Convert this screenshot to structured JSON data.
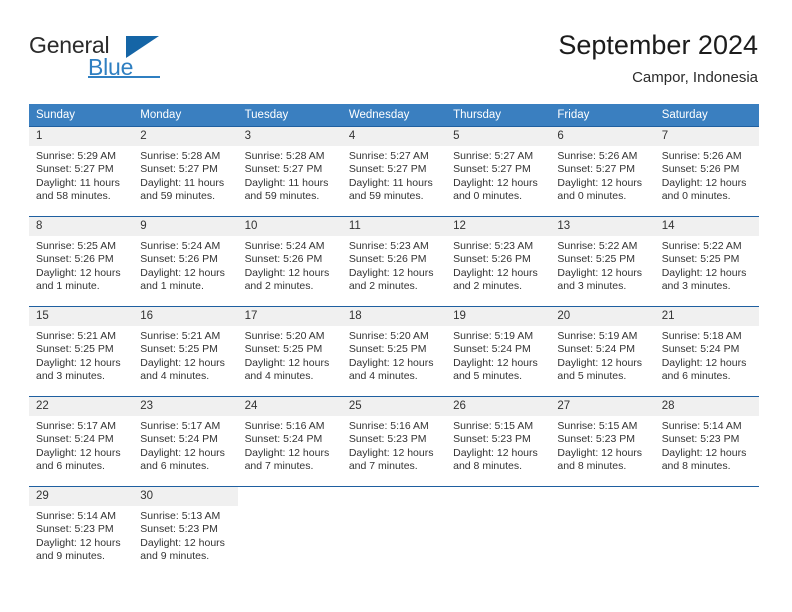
{
  "brand": {
    "name_part1": "General",
    "name_part2": "Blue",
    "logo_icon": "triangle-flag-icon"
  },
  "header": {
    "month_title": "September 2024",
    "location": "Campor, Indonesia"
  },
  "calendar": {
    "weekday_headers": [
      "Sunday",
      "Monday",
      "Tuesday",
      "Wednesday",
      "Thursday",
      "Friday",
      "Saturday"
    ],
    "accent_color": "#3a7fc0",
    "border_color": "#1f5fa0",
    "daynum_band_color": "#f0f0f0",
    "weeks": [
      [
        {
          "day": "1",
          "sunrise": "Sunrise: 5:29 AM",
          "sunset": "Sunset: 5:27 PM",
          "daylight_line1": "Daylight: 11 hours",
          "daylight_line2": "and 58 minutes."
        },
        {
          "day": "2",
          "sunrise": "Sunrise: 5:28 AM",
          "sunset": "Sunset: 5:27 PM",
          "daylight_line1": "Daylight: 11 hours",
          "daylight_line2": "and 59 minutes."
        },
        {
          "day": "3",
          "sunrise": "Sunrise: 5:28 AM",
          "sunset": "Sunset: 5:27 PM",
          "daylight_line1": "Daylight: 11 hours",
          "daylight_line2": "and 59 minutes."
        },
        {
          "day": "4",
          "sunrise": "Sunrise: 5:27 AM",
          "sunset": "Sunset: 5:27 PM",
          "daylight_line1": "Daylight: 11 hours",
          "daylight_line2": "and 59 minutes."
        },
        {
          "day": "5",
          "sunrise": "Sunrise: 5:27 AM",
          "sunset": "Sunset: 5:27 PM",
          "daylight_line1": "Daylight: 12 hours",
          "daylight_line2": "and 0 minutes."
        },
        {
          "day": "6",
          "sunrise": "Sunrise: 5:26 AM",
          "sunset": "Sunset: 5:27 PM",
          "daylight_line1": "Daylight: 12 hours",
          "daylight_line2": "and 0 minutes."
        },
        {
          "day": "7",
          "sunrise": "Sunrise: 5:26 AM",
          "sunset": "Sunset: 5:26 PM",
          "daylight_line1": "Daylight: 12 hours",
          "daylight_line2": "and 0 minutes."
        }
      ],
      [
        {
          "day": "8",
          "sunrise": "Sunrise: 5:25 AM",
          "sunset": "Sunset: 5:26 PM",
          "daylight_line1": "Daylight: 12 hours",
          "daylight_line2": "and 1 minute."
        },
        {
          "day": "9",
          "sunrise": "Sunrise: 5:24 AM",
          "sunset": "Sunset: 5:26 PM",
          "daylight_line1": "Daylight: 12 hours",
          "daylight_line2": "and 1 minute."
        },
        {
          "day": "10",
          "sunrise": "Sunrise: 5:24 AM",
          "sunset": "Sunset: 5:26 PM",
          "daylight_line1": "Daylight: 12 hours",
          "daylight_line2": "and 2 minutes."
        },
        {
          "day": "11",
          "sunrise": "Sunrise: 5:23 AM",
          "sunset": "Sunset: 5:26 PM",
          "daylight_line1": "Daylight: 12 hours",
          "daylight_line2": "and 2 minutes."
        },
        {
          "day": "12",
          "sunrise": "Sunrise: 5:23 AM",
          "sunset": "Sunset: 5:26 PM",
          "daylight_line1": "Daylight: 12 hours",
          "daylight_line2": "and 2 minutes."
        },
        {
          "day": "13",
          "sunrise": "Sunrise: 5:22 AM",
          "sunset": "Sunset: 5:25 PM",
          "daylight_line1": "Daylight: 12 hours",
          "daylight_line2": "and 3 minutes."
        },
        {
          "day": "14",
          "sunrise": "Sunrise: 5:22 AM",
          "sunset": "Sunset: 5:25 PM",
          "daylight_line1": "Daylight: 12 hours",
          "daylight_line2": "and 3 minutes."
        }
      ],
      [
        {
          "day": "15",
          "sunrise": "Sunrise: 5:21 AM",
          "sunset": "Sunset: 5:25 PM",
          "daylight_line1": "Daylight: 12 hours",
          "daylight_line2": "and 3 minutes."
        },
        {
          "day": "16",
          "sunrise": "Sunrise: 5:21 AM",
          "sunset": "Sunset: 5:25 PM",
          "daylight_line1": "Daylight: 12 hours",
          "daylight_line2": "and 4 minutes."
        },
        {
          "day": "17",
          "sunrise": "Sunrise: 5:20 AM",
          "sunset": "Sunset: 5:25 PM",
          "daylight_line1": "Daylight: 12 hours",
          "daylight_line2": "and 4 minutes."
        },
        {
          "day": "18",
          "sunrise": "Sunrise: 5:20 AM",
          "sunset": "Sunset: 5:25 PM",
          "daylight_line1": "Daylight: 12 hours",
          "daylight_line2": "and 4 minutes."
        },
        {
          "day": "19",
          "sunrise": "Sunrise: 5:19 AM",
          "sunset": "Sunset: 5:24 PM",
          "daylight_line1": "Daylight: 12 hours",
          "daylight_line2": "and 5 minutes."
        },
        {
          "day": "20",
          "sunrise": "Sunrise: 5:19 AM",
          "sunset": "Sunset: 5:24 PM",
          "daylight_line1": "Daylight: 12 hours",
          "daylight_line2": "and 5 minutes."
        },
        {
          "day": "21",
          "sunrise": "Sunrise: 5:18 AM",
          "sunset": "Sunset: 5:24 PM",
          "daylight_line1": "Daylight: 12 hours",
          "daylight_line2": "and 6 minutes."
        }
      ],
      [
        {
          "day": "22",
          "sunrise": "Sunrise: 5:17 AM",
          "sunset": "Sunset: 5:24 PM",
          "daylight_line1": "Daylight: 12 hours",
          "daylight_line2": "and 6 minutes."
        },
        {
          "day": "23",
          "sunrise": "Sunrise: 5:17 AM",
          "sunset": "Sunset: 5:24 PM",
          "daylight_line1": "Daylight: 12 hours",
          "daylight_line2": "and 6 minutes."
        },
        {
          "day": "24",
          "sunrise": "Sunrise: 5:16 AM",
          "sunset": "Sunset: 5:24 PM",
          "daylight_line1": "Daylight: 12 hours",
          "daylight_line2": "and 7 minutes."
        },
        {
          "day": "25",
          "sunrise": "Sunrise: 5:16 AM",
          "sunset": "Sunset: 5:23 PM",
          "daylight_line1": "Daylight: 12 hours",
          "daylight_line2": "and 7 minutes."
        },
        {
          "day": "26",
          "sunrise": "Sunrise: 5:15 AM",
          "sunset": "Sunset: 5:23 PM",
          "daylight_line1": "Daylight: 12 hours",
          "daylight_line2": "and 8 minutes."
        },
        {
          "day": "27",
          "sunrise": "Sunrise: 5:15 AM",
          "sunset": "Sunset: 5:23 PM",
          "daylight_line1": "Daylight: 12 hours",
          "daylight_line2": "and 8 minutes."
        },
        {
          "day": "28",
          "sunrise": "Sunrise: 5:14 AM",
          "sunset": "Sunset: 5:23 PM",
          "daylight_line1": "Daylight: 12 hours",
          "daylight_line2": "and 8 minutes."
        }
      ],
      [
        {
          "day": "29",
          "sunrise": "Sunrise: 5:14 AM",
          "sunset": "Sunset: 5:23 PM",
          "daylight_line1": "Daylight: 12 hours",
          "daylight_line2": "and 9 minutes."
        },
        {
          "day": "30",
          "sunrise": "Sunrise: 5:13 AM",
          "sunset": "Sunset: 5:23 PM",
          "daylight_line1": "Daylight: 12 hours",
          "daylight_line2": "and 9 minutes."
        },
        {
          "day": "",
          "sunrise": "",
          "sunset": "",
          "daylight_line1": "",
          "daylight_line2": ""
        },
        {
          "day": "",
          "sunrise": "",
          "sunset": "",
          "daylight_line1": "",
          "daylight_line2": ""
        },
        {
          "day": "",
          "sunrise": "",
          "sunset": "",
          "daylight_line1": "",
          "daylight_line2": ""
        },
        {
          "day": "",
          "sunrise": "",
          "sunset": "",
          "daylight_line1": "",
          "daylight_line2": ""
        },
        {
          "day": "",
          "sunrise": "",
          "sunset": "",
          "daylight_line1": "",
          "daylight_line2": ""
        }
      ]
    ]
  }
}
